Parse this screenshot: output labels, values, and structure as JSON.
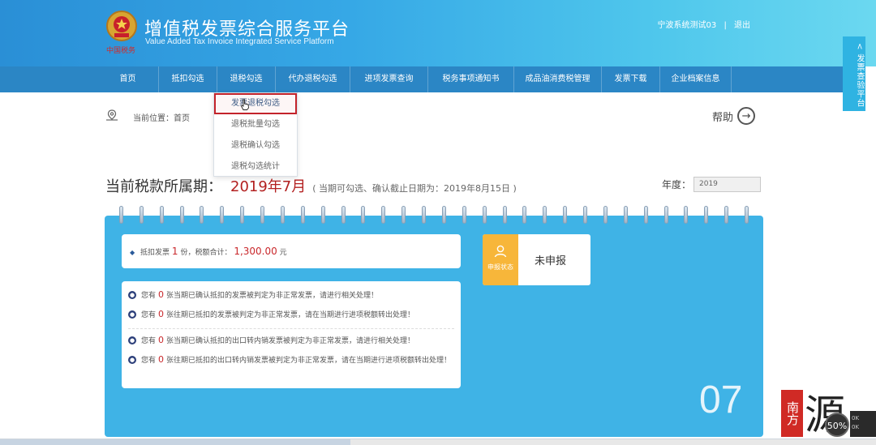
{
  "header": {
    "emblem_caption": "中国税务",
    "title_cn": "增值税发票综合服务平台",
    "title_en": "Value Added Tax Invoice Integrated Service Platform",
    "user": "宁波系统测试03",
    "separator": "|",
    "logout": "退出"
  },
  "nav": {
    "items": [
      {
        "label": "首页"
      },
      {
        "label": "抵扣勾选"
      },
      {
        "label": "退税勾选"
      },
      {
        "label": "代办退税勾选"
      },
      {
        "label": "进项发票查询"
      },
      {
        "label": "税务事项通知书"
      },
      {
        "label": "成品油消费税管理"
      },
      {
        "label": "发票下载"
      },
      {
        "label": "企业档案信息"
      }
    ]
  },
  "dropdown": {
    "items": [
      {
        "label": "发票退税勾选",
        "active": true
      },
      {
        "label": "退税批量勾选",
        "active": false
      },
      {
        "label": "退税确认勾选",
        "active": false
      },
      {
        "label": "退税勾选统计",
        "active": false
      }
    ]
  },
  "side_tab": {
    "label": "< 发票查验平台"
  },
  "breadcrumb": {
    "label": "当前位置：首页"
  },
  "help": {
    "label": "帮助",
    "icon_glyph": "→"
  },
  "period": {
    "label": "当前税款所属期：",
    "value": "2019年7月",
    "note": "( 当期可勾选、确认截止日期为：2019年8月15日 )"
  },
  "year": {
    "label": "年度：",
    "value": "2019"
  },
  "summary": {
    "bullet": "◆",
    "prefix": "抵扣发票",
    "count": "1",
    "unit": "份，税额合计：",
    "amount": "1,300.00",
    "currency": "元"
  },
  "notices": [
    {
      "pre": "您有",
      "num": "0",
      "post": "张当期已确认抵扣的发票被判定为非正常发票，请进行相关处理！"
    },
    {
      "pre": "您有",
      "num": "0",
      "post": "张往期已抵扣的发票被判定为非正常发票，请在当期进行进项税额转出处理！"
    },
    {
      "pre": "您有",
      "num": "0",
      "post": "张当期已确认抵扣的出口转内销发票被判定为非正常发票，请进行相关处理！"
    },
    {
      "pre": "您有",
      "num": "0",
      "post": "张往期已抵扣的出口转内销发票被判定为非正常发票，请在当期进行进项税额转出处理！"
    }
  ],
  "status": {
    "label": "申报状态",
    "value": "未申报"
  },
  "month_big": "07",
  "watermark": {
    "box_text": "南方",
    "big_char": "源"
  },
  "overlay": {
    "zoom": "50%",
    "net_up": "0K",
    "net_down": "0K"
  },
  "colors": {
    "header_start": "#2a8fd6",
    "nav_bg": "#2b86c5",
    "panel_bg": "#3fb3e6",
    "accent_red": "#c9282c",
    "status_orange": "#f7b63a"
  },
  "scroll": {
    "progress": 0.4
  }
}
